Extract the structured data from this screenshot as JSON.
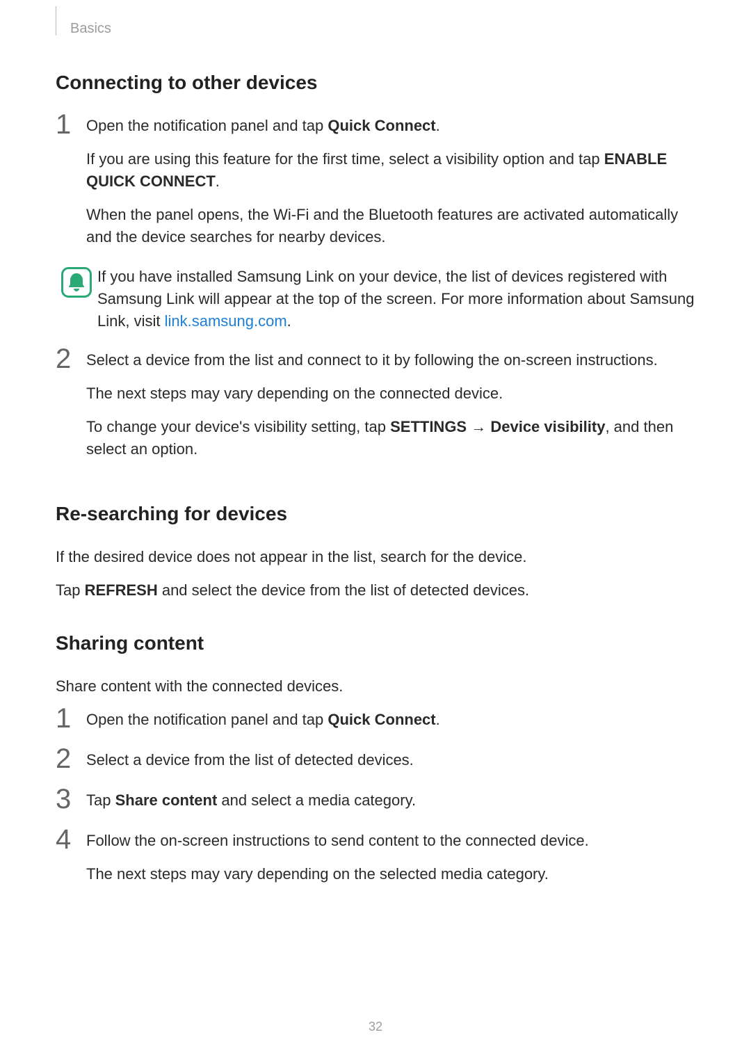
{
  "header": {
    "section": "Basics"
  },
  "s1": {
    "title": "Connecting to other devices",
    "step1_num": "1",
    "step1_p1_a": "Open the notification panel and tap ",
    "step1_p1_b": "Quick Connect",
    "step1_p1_c": ".",
    "step1_p2_a": "If you are using this feature for the first time, select a visibility option and tap ",
    "step1_p2_b": "ENABLE QUICK CONNECT",
    "step1_p2_c": ".",
    "step1_p3": "When the panel opens, the Wi-Fi and the Bluetooth features are activated automatically and the device searches for nearby devices.",
    "note_a": "If you have installed Samsung Link on your device, the list of devices registered with Samsung Link will appear at the top of the screen. For more information about Samsung Link, visit ",
    "note_link": "link.samsung.com",
    "note_b": ".",
    "step2_num": "2",
    "step2_p1": "Select a device from the list and connect to it by following the on-screen instructions.",
    "step2_p2": "The next steps may vary depending on the connected device.",
    "step2_p3_a": "To change your device's visibility setting, tap ",
    "step2_p3_b": "SETTINGS",
    "step2_p3_arrow": " → ",
    "step2_p3_c": "Device visibility",
    "step2_p3_d": ", and then select an option."
  },
  "s2": {
    "title": "Re-searching for devices",
    "p1": "If the desired device does not appear in the list, search for the device.",
    "p2_a": "Tap ",
    "p2_b": "REFRESH",
    "p2_c": " and select the device from the list of detected devices."
  },
  "s3": {
    "title": "Sharing content",
    "p1": "Share content with the connected devices.",
    "step1_num": "1",
    "step1_a": "Open the notification panel and tap ",
    "step1_b": "Quick Connect",
    "step1_c": ".",
    "step2_num": "2",
    "step2": "Select a device from the list of detected devices.",
    "step3_num": "3",
    "step3_a": "Tap ",
    "step3_b": "Share content",
    "step3_c": " and select a media category.",
    "step4_num": "4",
    "step4_p1": "Follow the on-screen instructions to send content to the connected device.",
    "step4_p2": "The next steps may vary depending on the selected media category."
  },
  "page_number": "32"
}
